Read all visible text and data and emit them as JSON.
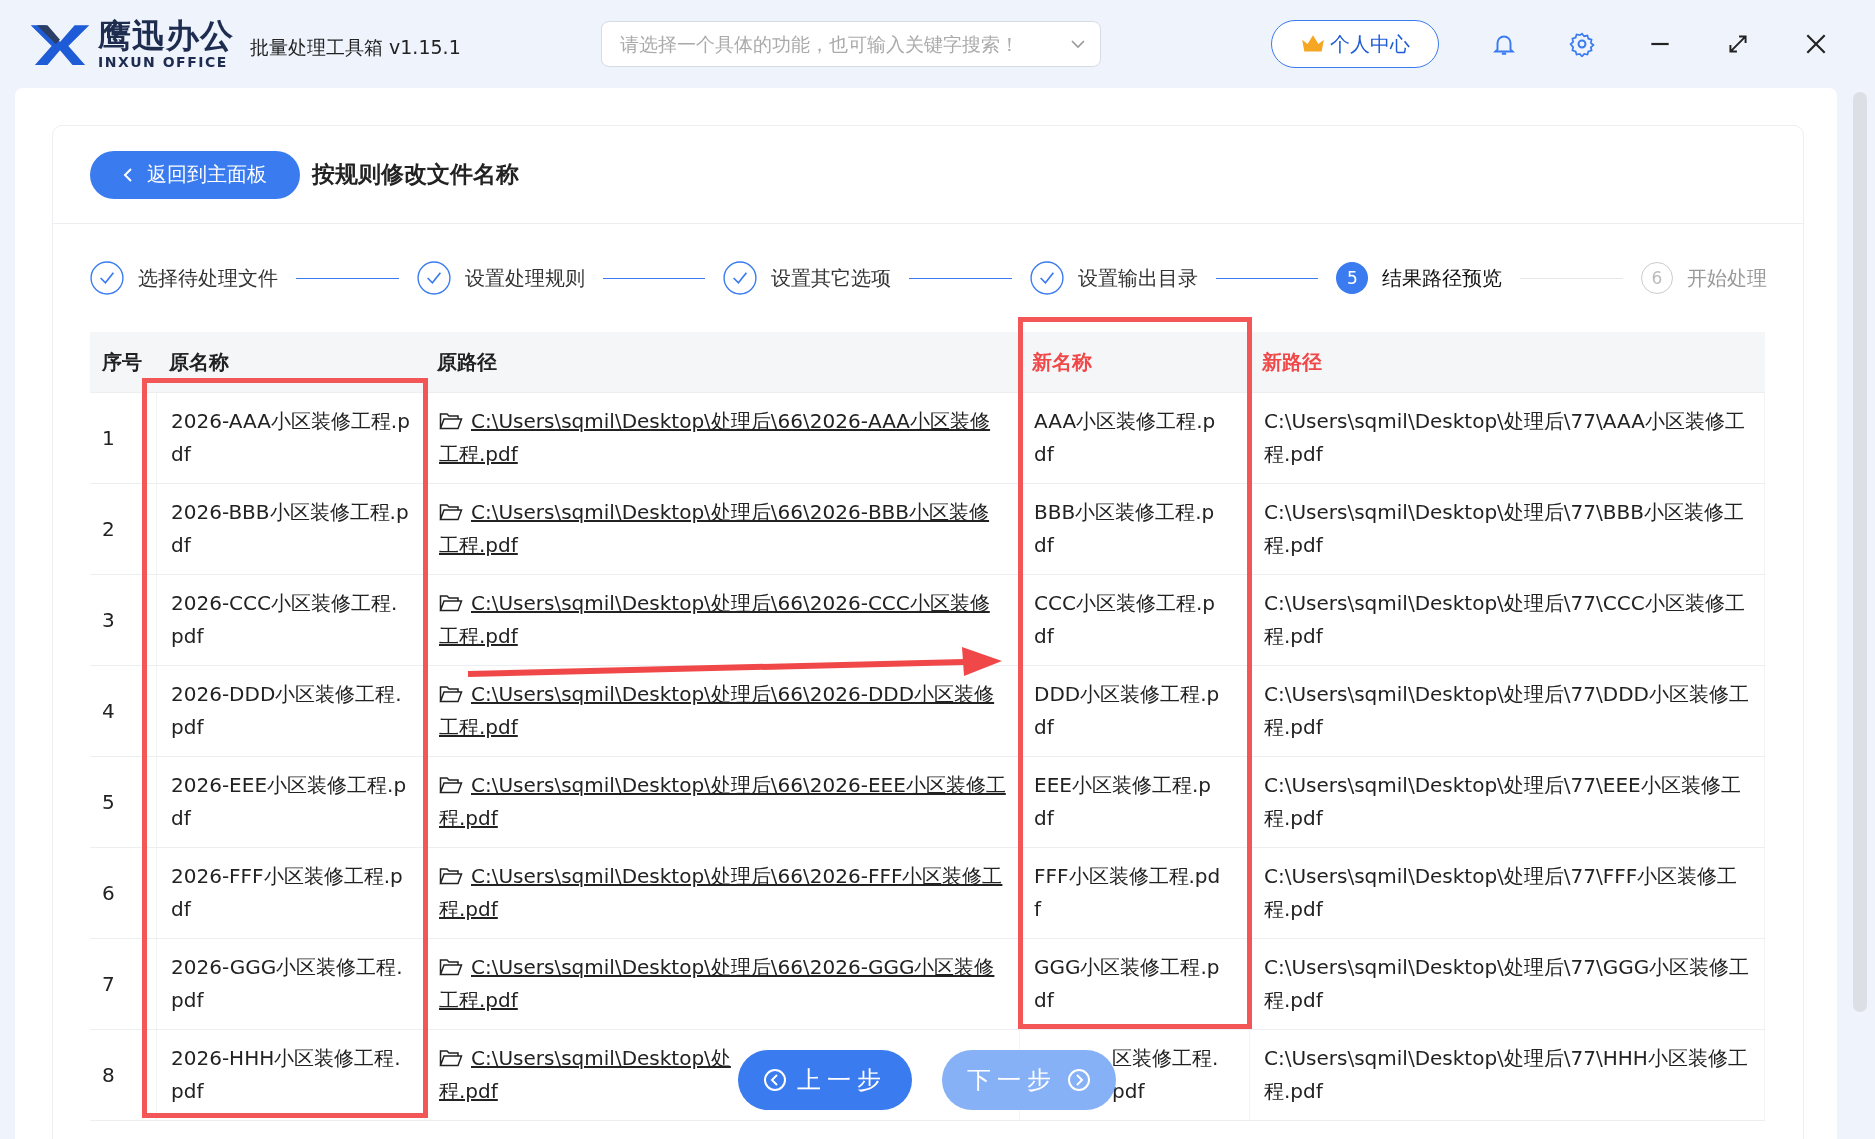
{
  "app": {
    "logo_text": "鹰迅办公",
    "logo_subtext": "INXUN OFFICE",
    "title": "批量处理工具箱 v1.15.1"
  },
  "search": {
    "placeholder": "请选择一个具体的功能，也可输入关键字搜索！"
  },
  "user_button": "个人中心",
  "page": {
    "back_button": "返回到主面板",
    "title": "按规则修改文件名称"
  },
  "steps": [
    {
      "label": "选择待处理文件",
      "done": true,
      "current": false
    },
    {
      "label": "设置处理规则",
      "done": true,
      "current": false
    },
    {
      "label": "设置其它选项",
      "done": true,
      "current": false
    },
    {
      "label": "设置输出目录",
      "done": true,
      "current": false
    },
    {
      "label": "结果路径预览",
      "done": false,
      "current": true,
      "number": "5"
    },
    {
      "label": "开始处理",
      "done": false,
      "current": false,
      "number": "6"
    }
  ],
  "table": {
    "columns": [
      {
        "label": "序号",
        "highlight": false
      },
      {
        "label": "原名称",
        "highlight": false
      },
      {
        "label": "原路径",
        "highlight": false
      },
      {
        "label": "新名称",
        "highlight": true
      },
      {
        "label": "新路径",
        "highlight": true
      }
    ],
    "rows": [
      {
        "index": "1",
        "orig_name": "2026-AAA小区装修工程.pdf",
        "orig_path": "C:\\Users\\sqmil\\Desktop\\处理后\\66\\2026-AAA小区装修工程.pdf",
        "new_name": "AAA小区装修工程.pdf",
        "new_path": "C:\\Users\\sqmil\\Desktop\\处理后\\77\\AAA小区装修工程.pdf"
      },
      {
        "index": "2",
        "orig_name": "2026-BBB小区装修工程.pdf",
        "orig_path": "C:\\Users\\sqmil\\Desktop\\处理后\\66\\2026-BBB小区装修工程.pdf",
        "new_name": "BBB小区装修工程.pdf",
        "new_path": "C:\\Users\\sqmil\\Desktop\\处理后\\77\\BBB小区装修工程.pdf"
      },
      {
        "index": "3",
        "orig_name": "2026-CCC小区装修工程.pdf",
        "orig_path": "C:\\Users\\sqmil\\Desktop\\处理后\\66\\2026-CCC小区装修工程.pdf",
        "new_name": "CCC小区装修工程.pdf",
        "new_path": "C:\\Users\\sqmil\\Desktop\\处理后\\77\\CCC小区装修工程.pdf"
      },
      {
        "index": "4",
        "orig_name": "2026-DDD小区装修工程.pdf",
        "orig_path": "C:\\Users\\sqmil\\Desktop\\处理后\\66\\2026-DDD小区装修工程.pdf",
        "new_name": "DDD小区装修工程.pdf",
        "new_path": "C:\\Users\\sqmil\\Desktop\\处理后\\77\\DDD小区装修工程.pdf"
      },
      {
        "index": "5",
        "orig_name": "2026-EEE小区装修工程.pdf",
        "orig_path": "C:\\Users\\sqmil\\Desktop\\处理后\\66\\2026-EEE小区装修工程.pdf",
        "new_name": "EEE小区装修工程.pdf",
        "new_path": "C:\\Users\\sqmil\\Desktop\\处理后\\77\\EEE小区装修工程.pdf"
      },
      {
        "index": "6",
        "orig_name": "2026-FFF小区装修工程.pdf",
        "orig_path": "C:\\Users\\sqmil\\Desktop\\处理后\\66\\2026-FFF小区装修工程.pdf",
        "new_name": "FFF小区装修工程.pdf",
        "new_path": "C:\\Users\\sqmil\\Desktop\\处理后\\77\\FFF小区装修工程.pdf"
      },
      {
        "index": "7",
        "orig_name": "2026-GGG小区装修工程.pdf",
        "orig_path": "C:\\Users\\sqmil\\Desktop\\处理后\\66\\2026-GGG小区装修工程.pdf",
        "new_name": "GGG小区装修工程.pdf",
        "new_path": "C:\\Users\\sqmil\\Desktop\\处理后\\77\\GGG小区装修工程.pdf"
      },
      {
        "index": "8",
        "orig_name": "2026-HHH小区装修工程.pdf",
        "orig_path_visible": [
          "C:\\Users\\sqmil\\Desktop\\处",
          "程.pdf"
        ],
        "new_name_visible": "区装修工程.pdf",
        "new_path": "C:\\Users\\sqmil\\Desktop\\处理后\\77\\HHH小区装修工程.pdf"
      }
    ]
  },
  "annotations": [
    {
      "kind": "box"
    },
    {
      "kind": "box"
    },
    {
      "kind": "arrow"
    }
  ],
  "nav_buttons": [
    {
      "label": "上一步",
      "disabled": false
    },
    {
      "label": "下一步",
      "disabled": true
    }
  ]
}
